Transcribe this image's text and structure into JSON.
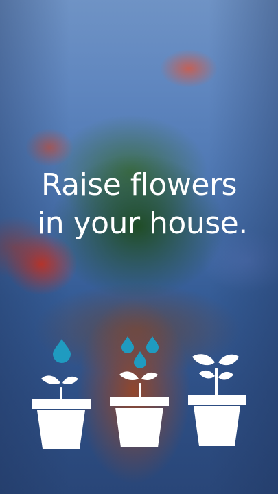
{
  "headline": {
    "line1": "Raise flowers",
    "line2": "in your house."
  },
  "illustrations": {
    "water_color": "#1f9bc0",
    "pot_color": "#ffffff",
    "steps": [
      {
        "icon": "sprout-pot-one-drop-icon",
        "drops": 1
      },
      {
        "icon": "sprout-pot-three-drops-icon",
        "drops": 3
      },
      {
        "icon": "grown-plant-pot-icon",
        "drops": 0
      }
    ]
  }
}
